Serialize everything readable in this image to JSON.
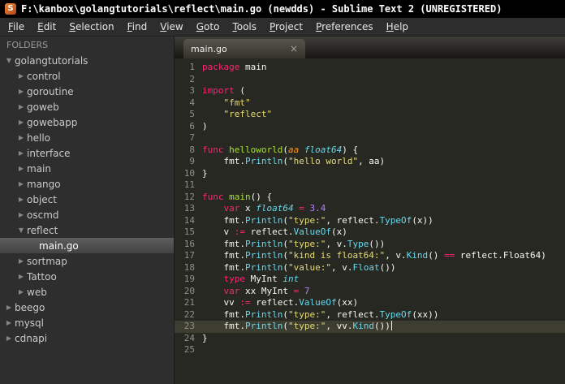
{
  "window": {
    "title": "F:\\kanbox\\golangtutorials\\reflect\\main.go (newdds) - Sublime Text 2 (UNREGISTERED)",
    "icon": "S"
  },
  "menu": {
    "items": [
      "File",
      "Edit",
      "Selection",
      "Find",
      "View",
      "Goto",
      "Tools",
      "Project",
      "Preferences",
      "Help"
    ]
  },
  "sidebar": {
    "header": "FOLDERS",
    "items": [
      {
        "label": "golangtutorials",
        "type": "folder",
        "expanded": true,
        "level": 0
      },
      {
        "label": "control",
        "type": "folder",
        "expanded": false,
        "level": 1
      },
      {
        "label": "goroutine",
        "type": "folder",
        "expanded": false,
        "level": 1
      },
      {
        "label": "goweb",
        "type": "folder",
        "expanded": false,
        "level": 1
      },
      {
        "label": "gowebapp",
        "type": "folder",
        "expanded": false,
        "level": 1
      },
      {
        "label": "hello",
        "type": "folder",
        "expanded": false,
        "level": 1
      },
      {
        "label": "interface",
        "type": "folder",
        "expanded": false,
        "level": 1
      },
      {
        "label": "main",
        "type": "folder",
        "expanded": false,
        "level": 1
      },
      {
        "label": "mango",
        "type": "folder",
        "expanded": false,
        "level": 1
      },
      {
        "label": "object",
        "type": "folder",
        "expanded": false,
        "level": 1
      },
      {
        "label": "oscmd",
        "type": "folder",
        "expanded": false,
        "level": 1
      },
      {
        "label": "reflect",
        "type": "folder",
        "expanded": true,
        "level": 1
      },
      {
        "label": "main.go",
        "type": "file",
        "level": 2,
        "selected": true
      },
      {
        "label": "sortmap",
        "type": "folder",
        "expanded": false,
        "level": 1
      },
      {
        "label": "Tattoo",
        "type": "folder",
        "expanded": false,
        "level": 1
      },
      {
        "label": "web",
        "type": "folder",
        "expanded": false,
        "level": 1
      },
      {
        "label": "beego",
        "type": "folder",
        "expanded": false,
        "level": 0
      },
      {
        "label": "mysql",
        "type": "folder",
        "expanded": false,
        "level": 0
      },
      {
        "label": "cdnapi",
        "type": "folder",
        "expanded": false,
        "level": 0
      }
    ]
  },
  "tabbar": {
    "tabs": [
      {
        "label": "main.go",
        "close": "×",
        "active": true
      }
    ]
  },
  "editor": {
    "language": "go",
    "current_line": 23,
    "lines": [
      {
        "n": 1,
        "tokens": [
          [
            "keyword",
            "package"
          ],
          [
            "plain",
            " main"
          ]
        ]
      },
      {
        "n": 2,
        "tokens": []
      },
      {
        "n": 3,
        "tokens": [
          [
            "keyword",
            "import"
          ],
          [
            "plain",
            " ("
          ]
        ]
      },
      {
        "n": 4,
        "tokens": [
          [
            "plain",
            "    "
          ],
          [
            "string",
            "\"fmt\""
          ]
        ]
      },
      {
        "n": 5,
        "tokens": [
          [
            "plain",
            "    "
          ],
          [
            "string",
            "\"reflect\""
          ]
        ]
      },
      {
        "n": 6,
        "tokens": [
          [
            "plain",
            ")"
          ]
        ]
      },
      {
        "n": 7,
        "tokens": []
      },
      {
        "n": 8,
        "tokens": [
          [
            "keyword",
            "func"
          ],
          [
            "plain",
            " "
          ],
          [
            "func",
            "helloworld"
          ],
          [
            "plain",
            "("
          ],
          [
            "param",
            "aa"
          ],
          [
            "plain",
            " "
          ],
          [
            "type",
            "float64"
          ],
          [
            "plain",
            ") {"
          ]
        ]
      },
      {
        "n": 9,
        "tokens": [
          [
            "plain",
            "    fmt."
          ],
          [
            "call",
            "Println"
          ],
          [
            "plain",
            "("
          ],
          [
            "string",
            "\"hello world\""
          ],
          [
            "plain",
            ", aa)"
          ]
        ]
      },
      {
        "n": 10,
        "tokens": [
          [
            "plain",
            "}"
          ]
        ]
      },
      {
        "n": 11,
        "tokens": []
      },
      {
        "n": 12,
        "tokens": [
          [
            "keyword",
            "func"
          ],
          [
            "plain",
            " "
          ],
          [
            "func",
            "main"
          ],
          [
            "plain",
            "() {"
          ]
        ]
      },
      {
        "n": 13,
        "tokens": [
          [
            "plain",
            "    "
          ],
          [
            "keyword",
            "var"
          ],
          [
            "plain",
            " x "
          ],
          [
            "type",
            "float64"
          ],
          [
            "plain",
            " "
          ],
          [
            "op",
            "="
          ],
          [
            "plain",
            " "
          ],
          [
            "number",
            "3.4"
          ]
        ]
      },
      {
        "n": 14,
        "tokens": [
          [
            "plain",
            "    fmt."
          ],
          [
            "call",
            "Println"
          ],
          [
            "plain",
            "("
          ],
          [
            "string",
            "\"type:\""
          ],
          [
            "plain",
            ", reflect."
          ],
          [
            "call",
            "TypeOf"
          ],
          [
            "plain",
            "(x))"
          ]
        ]
      },
      {
        "n": 15,
        "tokens": [
          [
            "plain",
            "    v "
          ],
          [
            "op",
            ":="
          ],
          [
            "plain",
            " reflect."
          ],
          [
            "call",
            "ValueOf"
          ],
          [
            "plain",
            "(x)"
          ]
        ]
      },
      {
        "n": 16,
        "tokens": [
          [
            "plain",
            "    fmt."
          ],
          [
            "call",
            "Println"
          ],
          [
            "plain",
            "("
          ],
          [
            "string",
            "\"type:\""
          ],
          [
            "plain",
            ", v."
          ],
          [
            "call",
            "Type"
          ],
          [
            "plain",
            "())"
          ]
        ]
      },
      {
        "n": 17,
        "tokens": [
          [
            "plain",
            "    fmt."
          ],
          [
            "call",
            "Println"
          ],
          [
            "plain",
            "("
          ],
          [
            "string",
            "\"kind is float64:\""
          ],
          [
            "plain",
            ", v."
          ],
          [
            "call",
            "Kind"
          ],
          [
            "plain",
            "() "
          ],
          [
            "op",
            "=="
          ],
          [
            "plain",
            " reflect.Float64)"
          ]
        ]
      },
      {
        "n": 18,
        "tokens": [
          [
            "plain",
            "    fmt."
          ],
          [
            "call",
            "Println"
          ],
          [
            "plain",
            "("
          ],
          [
            "string",
            "\"value:\""
          ],
          [
            "plain",
            ", v."
          ],
          [
            "call",
            "Float"
          ],
          [
            "plain",
            "())"
          ]
        ]
      },
      {
        "n": 19,
        "tokens": [
          [
            "plain",
            "    "
          ],
          [
            "keyword",
            "type"
          ],
          [
            "plain",
            " MyInt "
          ],
          [
            "type",
            "int"
          ]
        ]
      },
      {
        "n": 20,
        "tokens": [
          [
            "plain",
            "    "
          ],
          [
            "keyword",
            "var"
          ],
          [
            "plain",
            " xx MyInt "
          ],
          [
            "op",
            "="
          ],
          [
            "plain",
            " "
          ],
          [
            "number",
            "7"
          ]
        ]
      },
      {
        "n": 21,
        "tokens": [
          [
            "plain",
            "    vv "
          ],
          [
            "op",
            ":="
          ],
          [
            "plain",
            " reflect."
          ],
          [
            "call",
            "ValueOf"
          ],
          [
            "plain",
            "(xx)"
          ]
        ]
      },
      {
        "n": 22,
        "tokens": [
          [
            "plain",
            "    fmt."
          ],
          [
            "call",
            "Println"
          ],
          [
            "plain",
            "("
          ],
          [
            "string",
            "\"type:\""
          ],
          [
            "plain",
            ", reflect."
          ],
          [
            "call",
            "TypeOf"
          ],
          [
            "plain",
            "(xx))"
          ]
        ]
      },
      {
        "n": 23,
        "current": true,
        "cursor": true,
        "tokens": [
          [
            "plain",
            "    fmt."
          ],
          [
            "call",
            "Println"
          ],
          [
            "plain",
            "("
          ],
          [
            "string",
            "\"type:\""
          ],
          [
            "plain",
            ", vv."
          ],
          [
            "call",
            "Kind"
          ],
          [
            "plain",
            "())"
          ]
        ]
      },
      {
        "n": 24,
        "tokens": [
          [
            "plain",
            "}"
          ]
        ]
      },
      {
        "n": 25,
        "tokens": []
      }
    ]
  },
  "colors": {
    "editor_bg": "#272822",
    "current_line_bg": "#3e3d32",
    "keyword": "#f92672",
    "type": "#66d9ef",
    "call": "#66d9ef",
    "string": "#e6db74",
    "number": "#ae81ff",
    "function": "#a6e22e",
    "param": "#fd971f",
    "text": "#f8f8f2",
    "line_number": "#8f908a",
    "titlebar_bg": "#000000",
    "sidebar_bg": "#2e2e2e"
  }
}
